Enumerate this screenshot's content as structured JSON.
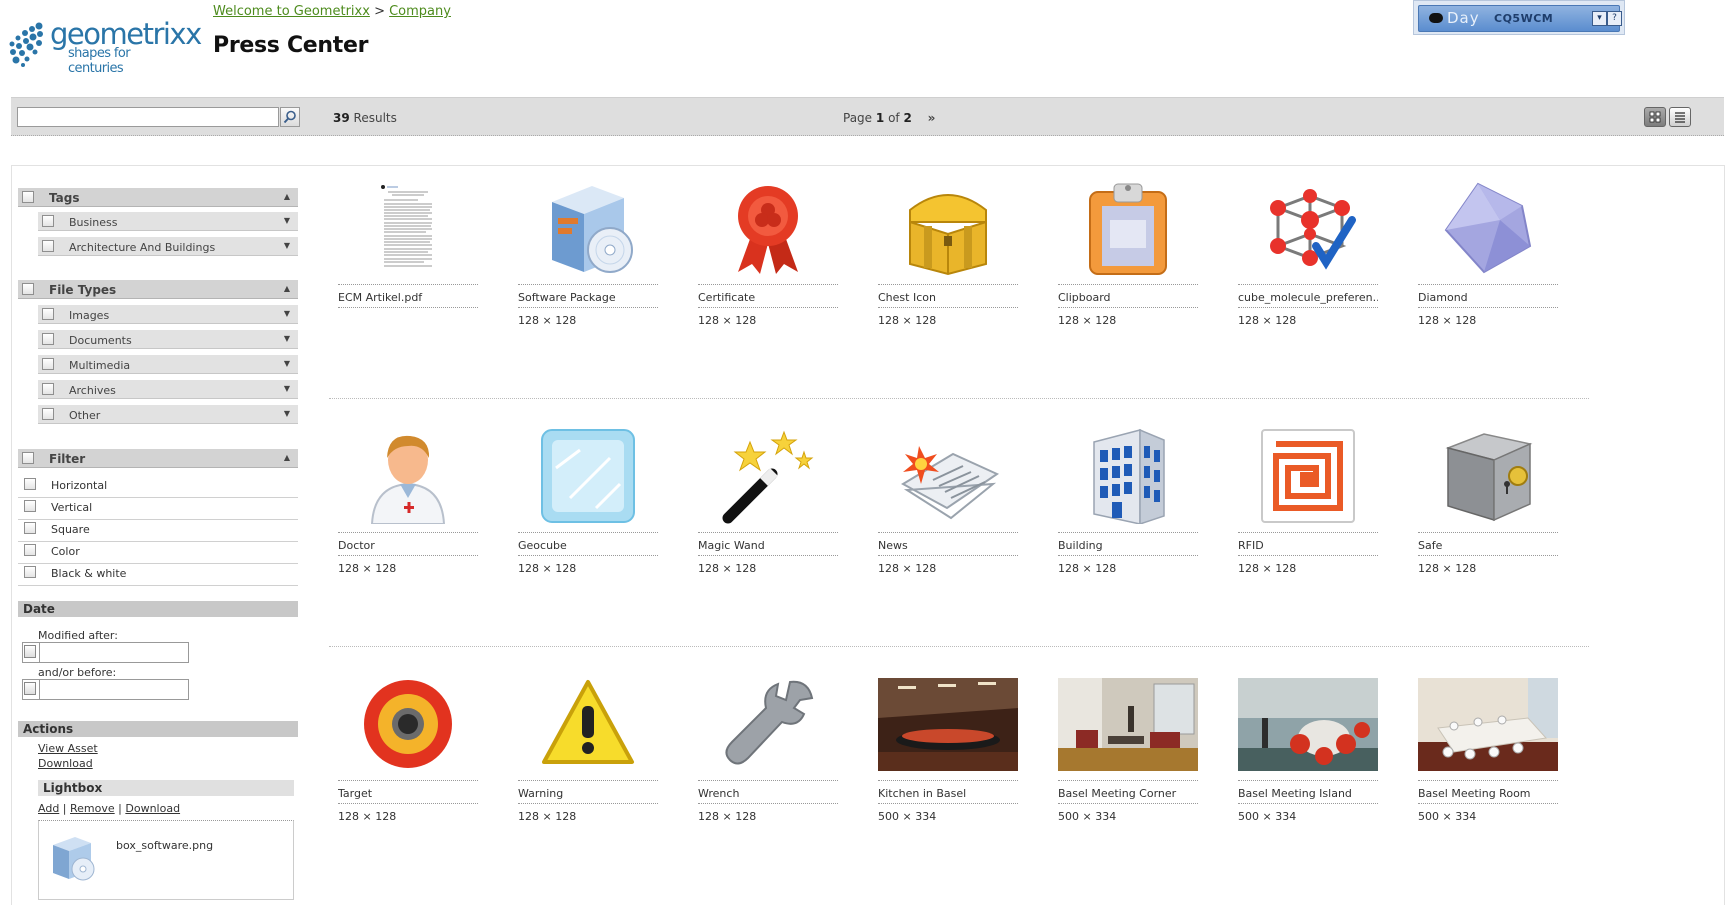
{
  "header": {
    "logo": {
      "brand": "geometrixx",
      "tagline": "shapes for centuries"
    },
    "breadcrumb": [
      {
        "label": "Welcome to Geometrixx"
      },
      {
        "label": "Company"
      }
    ],
    "breadcrumb_separator": ">",
    "page_title": "Press Center",
    "cq_bar": {
      "day_label": "Day",
      "product_label": "CQ5WCM",
      "menu_icon": "chevron-down-icon",
      "help_label": "?"
    }
  },
  "toolbar": {
    "search": {
      "value": "",
      "placeholder": ""
    },
    "results_count": "39",
    "results_label": "Results",
    "page_prefix": "Page",
    "page_current": "1",
    "page_of": "of",
    "page_total": "2",
    "next_label": "»",
    "views": [
      "grid-view-icon",
      "list-view-icon"
    ]
  },
  "sidebar": {
    "tags": {
      "label": "Tags",
      "items": [
        "Business",
        "Architecture And Buildings"
      ]
    },
    "file_types": {
      "label": "File Types",
      "items": [
        "Images",
        "Documents",
        "Multimedia",
        "Archives",
        "Other"
      ]
    },
    "filter": {
      "label": "Filter",
      "options": [
        "Horizontal",
        "Vertical",
        "Square",
        "Color",
        "Black & white"
      ]
    },
    "date": {
      "label": "Date",
      "modified_after": "Modified after:",
      "and_or_before": "and/or before:"
    },
    "actions": {
      "label": "Actions",
      "view_asset": "View Asset",
      "download": "Download"
    },
    "lightbox": {
      "label": "Lightbox",
      "add": "Add",
      "remove": "Remove",
      "download": "Download",
      "separator": "|",
      "item": "box_software.png"
    }
  },
  "assets": [
    {
      "title": "ECM Artikel.pdf",
      "dims": "",
      "icon": "pdf-document-icon"
    },
    {
      "title": "Software Package",
      "dims": "128 × 128",
      "icon": "software-box-icon"
    },
    {
      "title": "Certificate",
      "dims": "128 × 128",
      "icon": "certificate-ribbon-icon"
    },
    {
      "title": "Chest Icon",
      "dims": "128 × 128",
      "icon": "treasure-chest-icon"
    },
    {
      "title": "Clipboard",
      "dims": "128 × 128",
      "icon": "clipboard-icon"
    },
    {
      "title": "cube_molecule_preferen...",
      "dims": "128 × 128",
      "icon": "cube-molecule-icon"
    },
    {
      "title": "Diamond",
      "dims": "128 × 128",
      "icon": "diamond-icon"
    },
    {
      "title": "Doctor",
      "dims": "128 × 128",
      "icon": "doctor-icon"
    },
    {
      "title": "Geocube",
      "dims": "128 × 128",
      "icon": "ice-cube-icon"
    },
    {
      "title": "Magic Wand",
      "dims": "128 × 128",
      "icon": "magic-wand-icon"
    },
    {
      "title": "News",
      "dims": "128 × 128",
      "icon": "newspaper-icon"
    },
    {
      "title": "Building",
      "dims": "128 × 128",
      "icon": "building-icon"
    },
    {
      "title": "RFID",
      "dims": "128 × 128",
      "icon": "rfid-icon"
    },
    {
      "title": "Safe",
      "dims": "128 × 128",
      "icon": "safe-icon"
    },
    {
      "title": "Target",
      "dims": "128 × 128",
      "icon": "target-icon"
    },
    {
      "title": "Warning",
      "dims": "128 × 128",
      "icon": "warning-icon"
    },
    {
      "title": "Wrench",
      "dims": "128 × 128",
      "icon": "wrench-icon"
    },
    {
      "title": "Kitchen in Basel",
      "dims": "500 × 334",
      "icon": "photo-kitchen"
    },
    {
      "title": "Basel Meeting Corner",
      "dims": "500 × 334",
      "icon": "photo-meeting-corner"
    },
    {
      "title": "Basel Meeting Island",
      "dims": "500 × 334",
      "icon": "photo-meeting-island"
    },
    {
      "title": "Basel Meeting Room",
      "dims": "500 × 334",
      "icon": "photo-meeting-room"
    }
  ],
  "colors": {
    "link_green": "#4d8b1d",
    "brand_blue": "#2a75a8",
    "panel_gray": "#d3d3d3"
  }
}
